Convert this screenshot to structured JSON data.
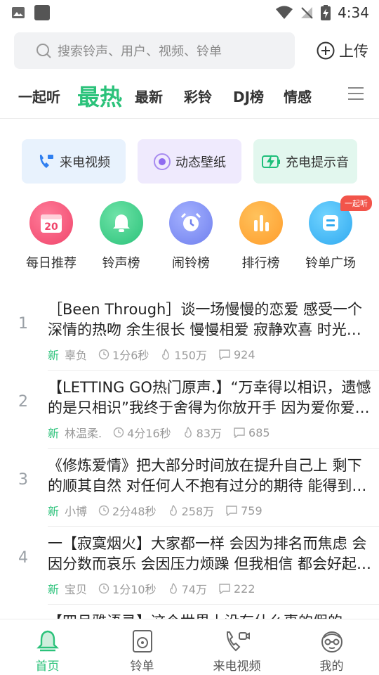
{
  "status_bar": {
    "time": "4:34"
  },
  "search": {
    "placeholder": "搜索铃声、用户、视频、铃单",
    "upload_label": "上传"
  },
  "tabs": [
    {
      "label": "一起听",
      "active": false
    },
    {
      "label": "最热",
      "active": true
    },
    {
      "label": "最新",
      "active": false
    },
    {
      "label": "彩铃",
      "active": false
    },
    {
      "label": "DJ榜",
      "active": false
    },
    {
      "label": "情感",
      "active": false
    }
  ],
  "features": [
    {
      "label": "来电视频",
      "icon": "phone-video-icon"
    },
    {
      "label": "动态壁纸",
      "icon": "wallpaper-icon"
    },
    {
      "label": "充电提示音",
      "icon": "charging-icon"
    }
  ],
  "categories": [
    {
      "label": "每日推荐",
      "icon": "calendar-icon",
      "icon_text": "20"
    },
    {
      "label": "铃声榜",
      "icon": "bell-icon"
    },
    {
      "label": "闹铃榜",
      "icon": "alarm-clock-icon"
    },
    {
      "label": "排行榜",
      "icon": "bars-icon"
    },
    {
      "label": "铃单广场",
      "icon": "playlist-icon",
      "badge": "一起听"
    }
  ],
  "songs": [
    {
      "rank": "1",
      "title": "［Been Through］谈一场慢慢的恋爱 感受一个深情的热吻 余生很长 慢慢相爱 寂静欢喜 时光深处",
      "tag": "新",
      "author": "辜负",
      "duration": "1分6秒",
      "plays": "150万",
      "comments": "924"
    },
    {
      "rank": "2",
      "title": "【LETTING GO热门原声.】“万幸得以相识，遗憾的是只相识”我终于舍得为你放开手 因为爱你爱到骨子里",
      "tag": "新",
      "author": "林温柔.",
      "duration": "4分16秒",
      "plays": "83万",
      "comments": "685"
    },
    {
      "rank": "3",
      "title": "《修炼爱情》把大部分时间放在提升自己上 剩下的顺其自然 对任何人不抱有过分的期待 能得到的都是惊喜",
      "tag": "新",
      "author": "小博",
      "duration": "2分48秒",
      "plays": "258万",
      "comments": "759"
    },
    {
      "rank": "4",
      "title": "一【寂寞烟火】大家都一样 会因为排名而焦虑 会因分数而哀乐 会因压力烦躁 但我相信 都会好起来的",
      "tag": "新",
      "author": "宝贝",
      "duration": "1分10秒",
      "plays": "74万",
      "comments": "222"
    },
    {
      "rank": "5",
      "title": "【四月雅语录】这个世界上没有什么事的假的",
      "tag": "",
      "author": "",
      "duration": "",
      "plays": "",
      "comments": ""
    }
  ],
  "bottom_nav": [
    {
      "label": "首页",
      "active": true
    },
    {
      "label": "铃单",
      "active": false
    },
    {
      "label": "来电视频",
      "active": false
    },
    {
      "label": "我的",
      "active": false
    }
  ],
  "colors": {
    "accent": "#2bc27a",
    "badge": "#f2544a"
  }
}
